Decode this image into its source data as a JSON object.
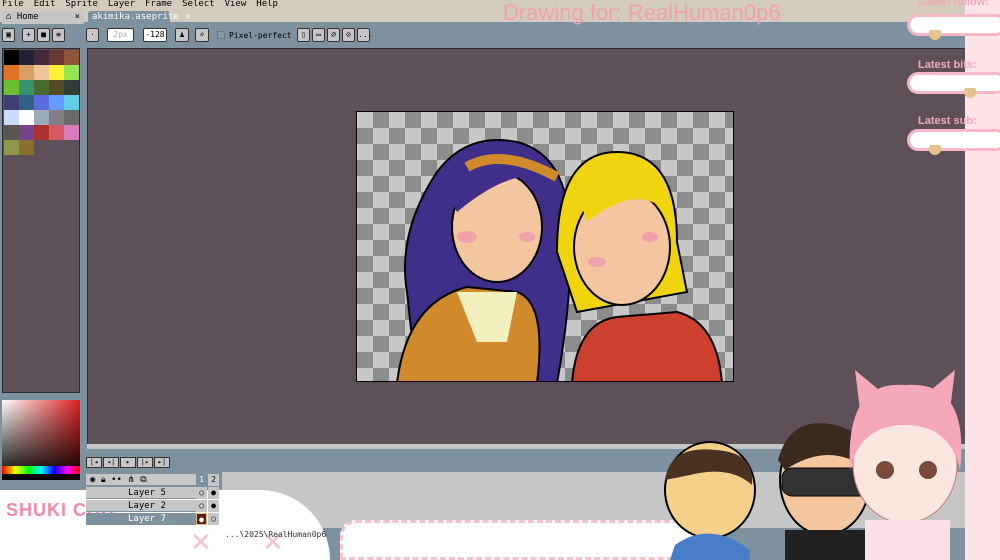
{
  "menu": [
    "File",
    "Edit",
    "Sprite",
    "Layer",
    "Frame",
    "Select",
    "View",
    "Help"
  ],
  "tabs": [
    {
      "label": "Home",
      "close": "×"
    },
    {
      "label": "akimika.aseprite",
      "close": "×"
    }
  ],
  "toolbar": {
    "brush_size": "2px",
    "angle": "-128",
    "pixel_perfect": "Pixel-perfect",
    "more": "..."
  },
  "palette": [
    "#000000",
    "#222034",
    "#45283c",
    "#663931",
    "#8f563b",
    "#df7126",
    "#d9a066",
    "#eec39a",
    "#fbf236",
    "#99e550",
    "#6abe30",
    "#37946e",
    "#4b692f",
    "#524b24",
    "#323c39",
    "#3f3f74",
    "#306082",
    "#5b6ee1",
    "#639bff",
    "#5fcde4",
    "#cbdbfc",
    "#ffffff",
    "#9badb7",
    "#847e87",
    "#696a6a",
    "#595652",
    "#76428a",
    "#ac3232",
    "#d95763",
    "#d77bba",
    "#8f974a",
    "#8a6f30"
  ],
  "timeline": {
    "frames": [
      "1",
      "2"
    ],
    "layers": [
      {
        "name": "Layer 5"
      },
      {
        "name": "Layer 2"
      },
      {
        "name": "Layer 7"
      }
    ],
    "path": "...\\2025\\RealHuman0p6"
  },
  "overlay": {
    "title": "Drawing for: RealHuman0p6",
    "latest_follow": "Latest follow:",
    "latest_bits": "Latest bits:",
    "latest_sub": "Latest sub:",
    "logo": "SHUKI CHU"
  }
}
